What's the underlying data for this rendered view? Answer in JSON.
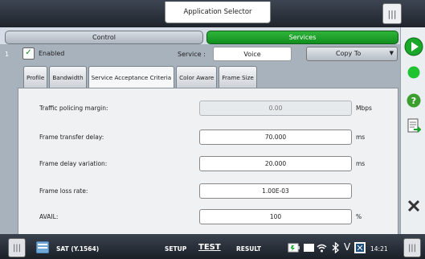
{
  "header": {
    "app_selector": "Application Selector"
  },
  "tabs": {
    "control": "Control",
    "services": "Services"
  },
  "service_row": {
    "index": "1",
    "enabled_label": "Enabled",
    "enabled_checked": true,
    "service_label": "Service :",
    "service_value": "Voice",
    "copy_to_label": "Copy To"
  },
  "subtabs": [
    "Profile",
    "Bandwidth",
    "Service Acceptance Criteria",
    "Color Aware",
    "Frame Size"
  ],
  "active_subtab": "Service Acceptance Criteria",
  "fields": [
    {
      "label": "Traffic policing margin:",
      "value": "0.00",
      "unit": "Mbps",
      "disabled": true
    },
    {
      "label": "Frame transfer delay:",
      "value": "70.000",
      "unit": "ms",
      "disabled": false
    },
    {
      "label": "Frame delay variation:",
      "value": "20.000",
      "unit": "ms",
      "disabled": false
    },
    {
      "label": "Frame loss rate:",
      "value": "1.00E-03",
      "unit": "",
      "disabled": false
    },
    {
      "label": "AVAIL:",
      "value": "100",
      "unit": "%",
      "disabled": false
    }
  ],
  "bottom_bar": {
    "app_name": "SAT (Y.1564)",
    "setup": "SETUP",
    "test": "TEST",
    "result": "RESULT",
    "time": "14:21"
  },
  "colors": {
    "accent_green": "#19a82a",
    "top_bar": "#2a313b"
  },
  "icons": [
    "start-icon",
    "status-led-icon",
    "help-icon",
    "report-icon",
    "close-icon",
    "app-icon",
    "battery-icon",
    "network-icon",
    "wifi-icon",
    "bluetooth-icon",
    "v-icon",
    "screen-icon"
  ]
}
